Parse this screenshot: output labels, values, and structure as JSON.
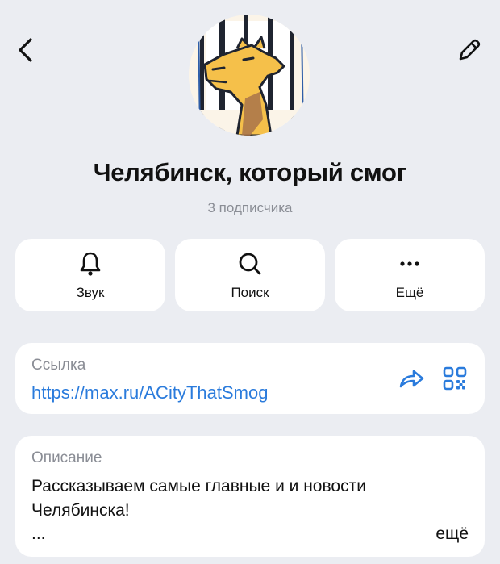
{
  "header": {
    "back_icon": "chevron-left-icon",
    "edit_icon": "pencil-icon"
  },
  "channel": {
    "title": "Челябинск, который смог",
    "subscribers": "3 подписчика",
    "avatar": "camel-illustration"
  },
  "actions": [
    {
      "label": "Звук",
      "icon": "bell-icon"
    },
    {
      "label": "Поиск",
      "icon": "search-icon"
    },
    {
      "label": "Ещё",
      "icon": "more-dots-icon"
    }
  ],
  "link": {
    "label": "Ссылка",
    "url": "https://max.ru/ACityThatSmog",
    "share_icon": "share-icon",
    "qr_icon": "qr-code-icon"
  },
  "description": {
    "label": "Описание",
    "text": "Рассказываем самые главные и и новости Челябинска!",
    "ellipsis": "...",
    "more": "ещё"
  },
  "colors": {
    "background": "#ebedf2",
    "card": "#ffffff",
    "accent": "#2a7bdc",
    "secondary_text": "#8a8d95"
  }
}
